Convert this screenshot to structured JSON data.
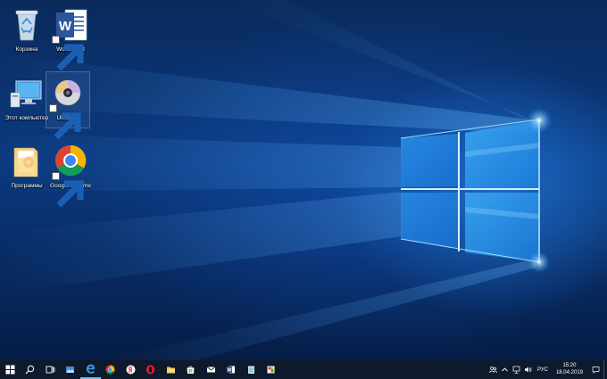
{
  "desktop": {
    "icons": [
      {
        "label": "Корзина",
        "icon": "recycle-bin-icon",
        "shortcut": false
      },
      {
        "label": "Word 2013",
        "icon": "word-icon",
        "shortcut": true
      },
      {
        "label": "Этот компьютер",
        "icon": "computer-icon",
        "shortcut": false
      },
      {
        "label": "UltraISO",
        "icon": "ultraiso-disc-icon",
        "shortcut": true
      },
      {
        "label": "Программы",
        "icon": "folder-icon",
        "shortcut": false
      },
      {
        "label": "Google Chrome",
        "icon": "chrome-icon",
        "shortcut": true
      }
    ]
  },
  "taskbar": {
    "pinned": [
      {
        "name": "start",
        "icon": "windows-start-icon"
      },
      {
        "name": "search",
        "icon": "search-icon"
      },
      {
        "name": "task-view",
        "icon": "task-view-icon"
      },
      {
        "name": "photos",
        "icon": "photos-icon"
      },
      {
        "name": "edge",
        "icon": "edge-icon"
      },
      {
        "name": "chrome",
        "icon": "chrome-icon"
      },
      {
        "name": "yandex",
        "icon": "yandex-browser-icon"
      },
      {
        "name": "opera",
        "icon": "opera-icon"
      },
      {
        "name": "explorer",
        "icon": "file-explorer-icon"
      },
      {
        "name": "store",
        "icon": "store-icon"
      },
      {
        "name": "mail",
        "icon": "mail-icon"
      },
      {
        "name": "word",
        "icon": "word-icon"
      },
      {
        "name": "notepad",
        "icon": "notepad-icon"
      },
      {
        "name": "paint",
        "icon": "paint-icon"
      }
    ],
    "tray": {
      "icons": [
        "people-icon",
        "chevron-up-icon",
        "network-icon",
        "volume-icon"
      ],
      "language": "РУС",
      "time": "15:20",
      "date": "18.04.2019"
    }
  },
  "colors": {
    "taskbar_bg": "#0e1a2c",
    "accent": "#76b9ed",
    "wallpaper_glow": "#6fd0ff"
  }
}
